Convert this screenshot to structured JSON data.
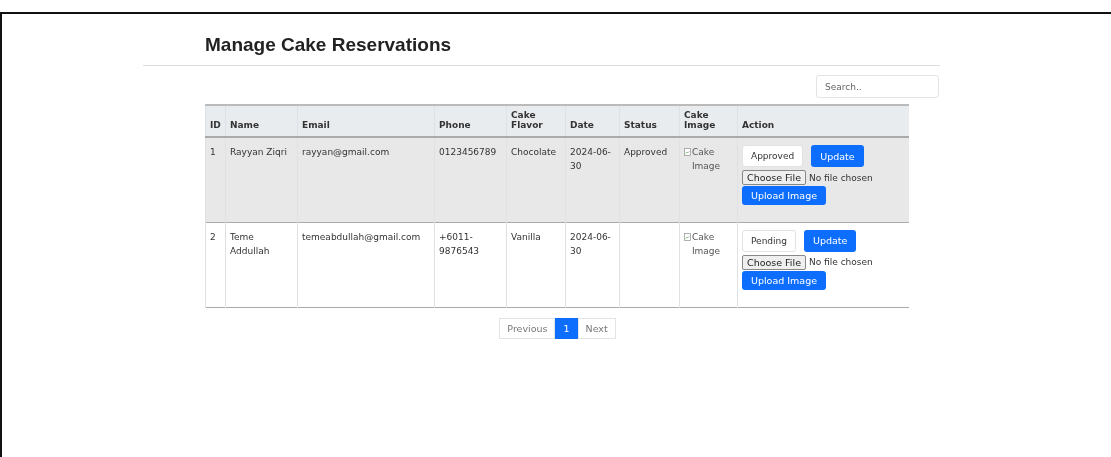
{
  "title": "Manage Cake Reservations",
  "search": {
    "placeholder": "Search.."
  },
  "table": {
    "columns": [
      "ID",
      "Name",
      "Email",
      "Phone",
      "Cake Flavor",
      "Date",
      "Status",
      "Cake Image",
      "Action"
    ],
    "rows": [
      {
        "id": "1",
        "name": "Rayyan Ziqri",
        "email": "rayyan@gmail.com",
        "phone": "0123456789",
        "flavor": "Chocolate",
        "date": "2024-06-30",
        "status": "Approved",
        "image_alt": "Cake Image",
        "status_select": "Approved",
        "update": "Update",
        "choose_file": "Choose File",
        "file_status": "No file chosen",
        "upload": "Upload Image",
        "selected": true
      },
      {
        "id": "2",
        "name": "Teme Addullah",
        "email": "temeabdullah@gmail.com",
        "phone": "+6011-9876543",
        "flavor": "Vanilla",
        "date": "2024-06-30",
        "image_alt": "Cake Image",
        "status_select": "Pending",
        "update": "Update",
        "choose_file": "Choose File",
        "file_status": "No file chosen",
        "upload": "Upload Image",
        "selected": false
      }
    ]
  },
  "pagination": [
    {
      "label": "Previous",
      "selected": false
    },
    {
      "label": "1",
      "selected": true
    },
    {
      "label": "Next",
      "selected": false
    }
  ]
}
